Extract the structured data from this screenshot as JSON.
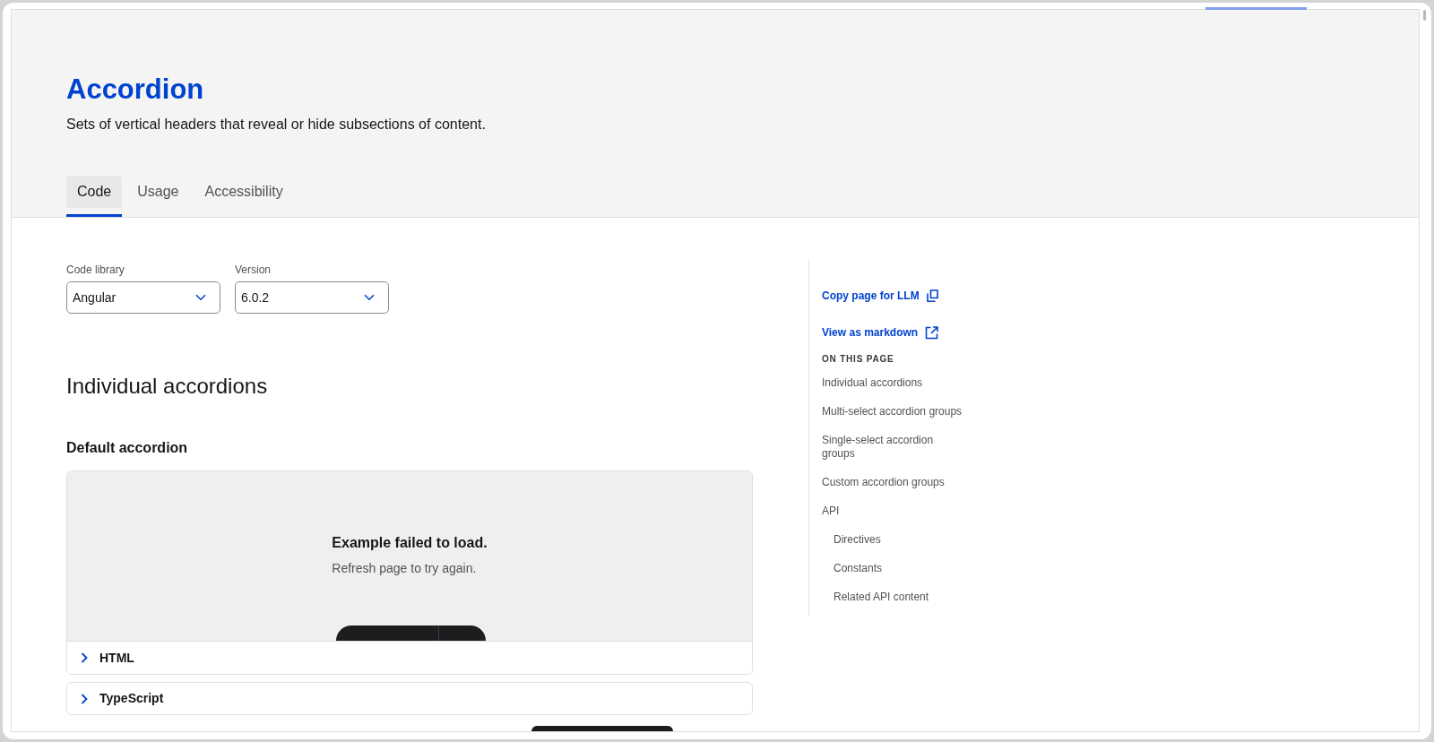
{
  "page_header": {
    "title": "Accordion",
    "description": "Sets of vertical headers that reveal or hide subsections of content.",
    "tabs": [
      {
        "label": "Code",
        "selected": true
      },
      {
        "label": "Usage",
        "selected": false
      },
      {
        "label": "Accessibility",
        "selected": false
      }
    ]
  },
  "selectors": [
    {
      "label": "Code library",
      "value": "Angular"
    },
    {
      "label": "Version",
      "value": "6.0.2"
    }
  ],
  "section_heading": "Individual accordions",
  "subsection_heading": "Default accordion",
  "example": {
    "error_title": "Example failed to load.",
    "error_message": "Refresh page to try again.",
    "code_panels": [
      {
        "label": "HTML",
        "expanded": false
      },
      {
        "label": "TypeScript",
        "expanded": false
      }
    ]
  },
  "sidebar": {
    "actions": [
      {
        "label": "Copy page for LLM",
        "kind": "copy"
      },
      {
        "label": "View as markdown",
        "kind": "external"
      }
    ],
    "toc_heading": "ON THIS PAGE",
    "toc": [
      {
        "label": "Individual accordions"
      },
      {
        "label": "Multi-select accordion groups"
      },
      {
        "label": "Single-select accordion groups"
      },
      {
        "label": "Custom accordion groups"
      },
      {
        "label": "API",
        "children": [
          {
            "label": "Directives"
          },
          {
            "label": "Constants"
          },
          {
            "label": "Related API content"
          }
        ]
      }
    ]
  }
}
